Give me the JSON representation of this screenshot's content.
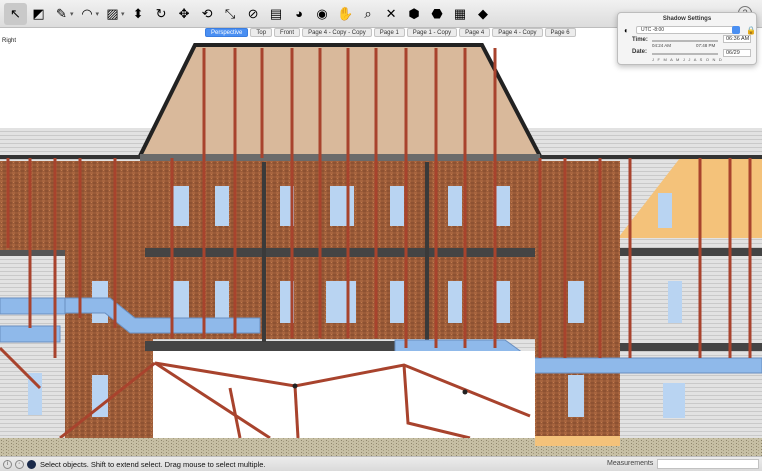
{
  "toolbar": {
    "tools": [
      {
        "name": "select-tool-icon",
        "glyph": "↖",
        "selected": true
      },
      {
        "name": "eraser-tool-icon",
        "glyph": "◩"
      },
      {
        "name": "pencil-tool-icon",
        "glyph": "✎",
        "caret": true
      },
      {
        "name": "arc-tool-icon",
        "glyph": "◠",
        "caret": true
      },
      {
        "name": "shape-tool-icon",
        "glyph": "▨",
        "caret": true
      },
      {
        "name": "push-pull-tool-icon",
        "glyph": "⬍"
      },
      {
        "name": "offset-tool-icon",
        "glyph": "↻"
      },
      {
        "name": "move-tool-icon",
        "glyph": "✥"
      },
      {
        "name": "rotate-tool-icon",
        "glyph": "⟲"
      },
      {
        "name": "scale-tool-icon",
        "glyph": "⤡"
      },
      {
        "name": "tape-measure-tool-icon",
        "glyph": "⊘"
      },
      {
        "name": "text-tool-icon",
        "glyph": "▤"
      },
      {
        "name": "paint-bucket-tool-icon",
        "glyph": "◕"
      },
      {
        "name": "orbit-tool-icon",
        "glyph": "◉"
      },
      {
        "name": "pan-tool-icon",
        "glyph": "✋"
      },
      {
        "name": "zoom-tool-icon",
        "glyph": "⌕"
      },
      {
        "name": "zoom-extents-tool-icon",
        "glyph": "✕"
      },
      {
        "name": "warehouse-tool-icon",
        "glyph": "⬢"
      },
      {
        "name": "extension-warehouse-icon",
        "glyph": "⬣"
      },
      {
        "name": "send-to-layout-icon",
        "glyph": "▦"
      },
      {
        "name": "extension-manager-icon",
        "glyph": "◆"
      }
    ],
    "help_glyph": "?"
  },
  "scene_tabs": [
    {
      "label": "Perspective",
      "active": true
    },
    {
      "label": "Top"
    },
    {
      "label": "Front"
    },
    {
      "label": "Page 4 - Copy - Copy"
    },
    {
      "label": "Page 1"
    },
    {
      "label": "Page 1 - Copy"
    },
    {
      "label": "Page 4"
    },
    {
      "label": "Page 4 - Copy"
    },
    {
      "label": "Page 6"
    }
  ],
  "view_label": "Right",
  "shadow_settings": {
    "title": "Shadow Settings",
    "timezone": "UTC -8:00",
    "time_label": "Time:",
    "date_label": "Date:",
    "time_start": "04:24 AM",
    "time_end": "07:48 PM",
    "time_value": "06:36 AM",
    "date_value": "06/29",
    "noon": "Noon",
    "months": "J F M A M J J A S O N D"
  },
  "status": {
    "message": "Select objects. Shift to extend select. Drag mouse to select multiple.",
    "measurements_label": "Measurements",
    "measurements_value": ""
  },
  "colors": {
    "brick": "#9e5f3a",
    "roof": "#d9b99b",
    "window": "#b9d4f2",
    "ground": "#c9c1a6",
    "tab_active": "#4a8ff2"
  }
}
